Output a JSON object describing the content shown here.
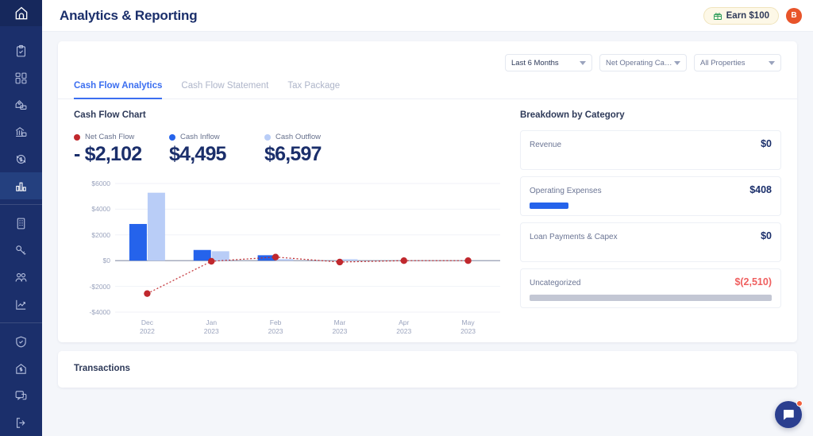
{
  "app": {
    "logo_icon": "home-shield-icon",
    "page_title": "Analytics & Reporting"
  },
  "sidebar": {
    "items": [
      {
        "icon": "clipboard-check-icon",
        "name": "tasks",
        "active": false
      },
      {
        "icon": "dashboard-grid-icon",
        "name": "dashboard",
        "active": false
      },
      {
        "icon": "property-money-icon",
        "name": "properties",
        "active": false
      },
      {
        "icon": "bank-icon",
        "name": "banking",
        "active": false
      },
      {
        "icon": "dollar-refresh-icon",
        "name": "payments",
        "active": false
      },
      {
        "icon": "bar-chart-icon",
        "name": "analytics",
        "active": true
      },
      {
        "icon": "building-icon",
        "name": "units",
        "active": false
      },
      {
        "icon": "key-icon",
        "name": "leases",
        "active": false
      },
      {
        "icon": "users-icon",
        "name": "tenants",
        "active": false
      },
      {
        "icon": "trending-up-icon",
        "name": "performance",
        "active": false
      },
      {
        "icon": "shield-check-icon",
        "name": "insurance",
        "active": false
      },
      {
        "icon": "home-dollar-icon",
        "name": "loans",
        "active": false
      },
      {
        "icon": "chat-help-icon",
        "name": "support",
        "active": false
      },
      {
        "icon": "logout-icon",
        "name": "logout",
        "active": false
      }
    ]
  },
  "topbar": {
    "earn_label": "Earn $100",
    "earn_icon": "gift-icon",
    "avatar_initial": "B"
  },
  "filters": [
    {
      "name": "date-range",
      "value": "Last 6 Months",
      "strong": true
    },
    {
      "name": "metric",
      "value": "Net Operating Cas...",
      "strong": false
    },
    {
      "name": "properties",
      "value": "All Properties",
      "strong": false
    }
  ],
  "tabs": [
    {
      "label": "Cash Flow Analytics",
      "active": true
    },
    {
      "label": "Cash Flow Statement",
      "active": false
    },
    {
      "label": "Tax Package",
      "active": false
    }
  ],
  "chart_section": {
    "title": "Cash Flow Chart",
    "legend": [
      {
        "label": "Net Cash Flow",
        "value": "- $2,102",
        "color": "#c0282d"
      },
      {
        "label": "Cash Inflow",
        "value": "$4,495",
        "color": "#2563eb"
      },
      {
        "label": "Cash Outflow",
        "value": "$6,597",
        "color": "#b9cdf7"
      }
    ]
  },
  "breakdown": {
    "title": "Breakdown by Category",
    "items": [
      {
        "name": "Revenue",
        "value": "$0",
        "bar_pct": 0,
        "bar_color": "#2563eb",
        "negative": false
      },
      {
        "name": "Operating Expenses",
        "value": "$408",
        "bar_pct": 16,
        "bar_color": "#2563eb",
        "negative": false
      },
      {
        "name": "Loan Payments & Capex",
        "value": "$0",
        "bar_pct": 0,
        "bar_color": "#2563eb",
        "negative": false
      },
      {
        "name": "Uncategorized",
        "value": "$(2,510)",
        "bar_pct": 100,
        "bar_color": "#c3c7d4",
        "negative": true
      }
    ]
  },
  "transactions": {
    "title": "Transactions"
  },
  "chat": {
    "icon": "chat-bubble-icon",
    "has_unread": true
  },
  "chart_data": {
    "type": "bar",
    "title": "Cash Flow Chart",
    "categories": [
      "Dec\n2022",
      "Jan\n2023",
      "Feb\n2023",
      "Mar\n2023",
      "Apr\n2023",
      "May\n2023"
    ],
    "category_labels": [
      {
        "month": "Dec",
        "year": "2022"
      },
      {
        "month": "Jan",
        "year": "2023"
      },
      {
        "month": "Feb",
        "year": "2023"
      },
      {
        "month": "Mar",
        "year": "2023"
      },
      {
        "month": "Apr",
        "year": "2023"
      },
      {
        "month": "May",
        "year": "2023"
      }
    ],
    "series": [
      {
        "name": "Cash Inflow",
        "type": "bar",
        "color": "#2563eb",
        "values": [
          2850,
          830,
          420,
          0,
          0,
          0
        ]
      },
      {
        "name": "Cash Outflow",
        "type": "bar",
        "color": "#b9cdf7",
        "values": [
          5280,
          730,
          120,
          110,
          0,
          0
        ]
      },
      {
        "name": "Net Cash Flow",
        "type": "line",
        "color": "#c0282d",
        "style": "dotted",
        "values": [
          -2560,
          -50,
          280,
          -110,
          0,
          0
        ]
      }
    ],
    "ylabel": "",
    "xlabel": "",
    "ylim": [
      -4000,
      6000
    ],
    "yticks": [
      6000,
      4000,
      2000,
      0,
      -2000,
      -4000
    ],
    "ytick_labels": [
      "$6000",
      "$4000",
      "$2000",
      "$0",
      "-$2000",
      "-$4000"
    ],
    "grid": true,
    "legend_position": "top-left"
  }
}
